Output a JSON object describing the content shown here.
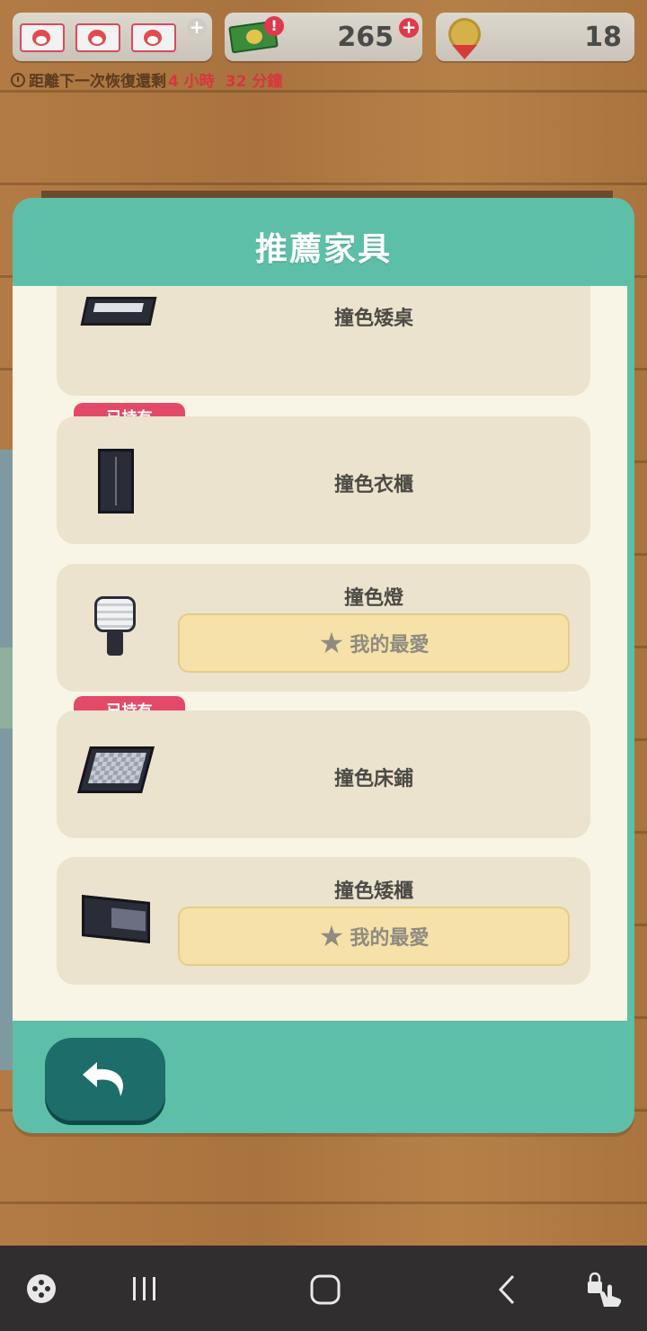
{
  "top_bar": {
    "tickets_count_shown": 3,
    "money_value": "265",
    "medal_value": "18",
    "timer_prefix": "距離下一次恢復還剩",
    "timer_hours": "4 小時",
    "timer_minutes": "32 分鐘"
  },
  "dialog": {
    "title": "推薦家具",
    "items": [
      {
        "name": "撞色矮桌",
        "owned": false,
        "favorite_button": false
      },
      {
        "name": "撞色衣櫃",
        "owned": true,
        "owned_label": "已持有",
        "favorite_button": false
      },
      {
        "name": "撞色燈",
        "owned": false,
        "favorite_button": true,
        "favorite_label": "我的最愛"
      },
      {
        "name": "撞色床鋪",
        "owned": true,
        "owned_label": "已持有",
        "favorite_button": false
      },
      {
        "name": "撞色矮櫃",
        "owned": false,
        "favorite_button": true,
        "favorite_label": "我的最愛"
      }
    ]
  },
  "icons": {
    "back": "back-arrow-icon",
    "star": "star-icon",
    "clock": "clock-icon"
  },
  "colors": {
    "dialog_teal": "#5dbfa8",
    "owned_badge": "#e24a68",
    "favorite_button": "#f6e1a9",
    "timer_red": "#d8363d"
  }
}
